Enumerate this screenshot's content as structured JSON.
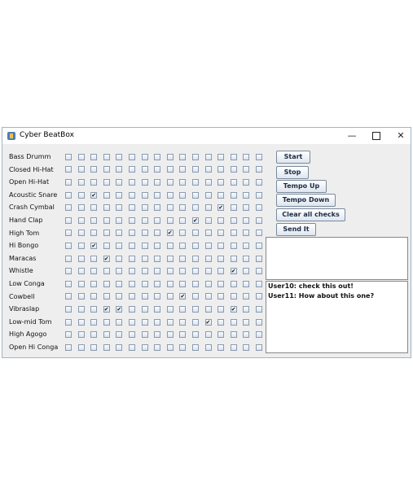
{
  "window": {
    "title": "Cyber BeatBox",
    "minimize_glyph": "—",
    "close_glyph": "✕"
  },
  "instruments": [
    {
      "label": "Bass Drumm",
      "checked": []
    },
    {
      "label": "Closed Hi-Hat",
      "checked": []
    },
    {
      "label": "Open Hi-Hat",
      "checked": []
    },
    {
      "label": "Acoustic Snare",
      "checked": [
        2
      ]
    },
    {
      "label": "Crash Cymbal",
      "checked": [
        12
      ]
    },
    {
      "label": "Hand Clap",
      "checked": [
        10
      ]
    },
    {
      "label": "High Tom",
      "checked": [
        8
      ]
    },
    {
      "label": "Hi Bongo",
      "checked": [
        2
      ]
    },
    {
      "label": "Maracas",
      "checked": [
        3
      ]
    },
    {
      "label": "Whistle",
      "checked": [
        13
      ]
    },
    {
      "label": "Low Conga",
      "checked": []
    },
    {
      "label": "Cowbell",
      "checked": [
        9
      ]
    },
    {
      "label": "Vibraslap",
      "checked": [
        3,
        4,
        13
      ]
    },
    {
      "label": "Low-mid Tom",
      "checked": [
        11
      ]
    },
    {
      "label": "High Agogo",
      "checked": []
    },
    {
      "label": "Open Hi Conga",
      "checked": []
    }
  ],
  "beats": 16,
  "buttons": {
    "start": "Start",
    "stop": "Stop",
    "tempo_up": "Tempo Up",
    "tempo_down": "Tempo Down",
    "clear": "Clear all checks",
    "send": "Send It"
  },
  "messages": [
    "User10: check this out!",
    "User11: How about this one?"
  ]
}
